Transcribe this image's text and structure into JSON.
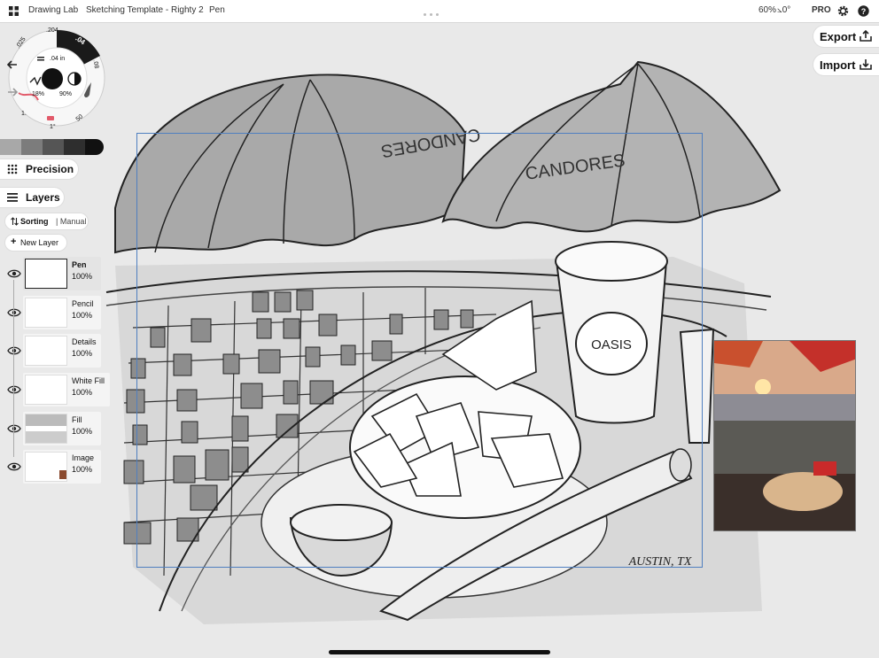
{
  "topbar": {
    "gallery": "Drawing Lab",
    "document": "Sketching Template - Righty 2",
    "tool": "Pen",
    "zoom": "60%",
    "rotation": "⦣0°",
    "pro": "PRO"
  },
  "brush_wheel": {
    "size_small": ".025",
    "size_mid": ".204",
    "size_active": ".04",
    "size_right": ".08",
    "size_center": ".04 in",
    "smoothing": "18%",
    "opacity": "90%",
    "value_bottom_left": "1.",
    "value_bottom": "1°",
    "value_bottom_right": "50"
  },
  "left_panel": {
    "precision": "Precision",
    "layers": "Layers",
    "sorting_label": "Sorting",
    "sorting_mode": "| Manual",
    "new_layer": "New Layer",
    "layers_list": [
      {
        "name": "Pen",
        "opacity": "100%",
        "active": true
      },
      {
        "name": "Pencil",
        "opacity": "100%"
      },
      {
        "name": "Details",
        "opacity": "100%"
      },
      {
        "name": "White Fill",
        "opacity": "100%"
      },
      {
        "name": "Fill",
        "opacity": "100%"
      },
      {
        "name": "Image",
        "opacity": "100%"
      }
    ]
  },
  "right_panel": {
    "export": "Export",
    "import": "Import"
  },
  "canvas": {
    "cup_text": "OASIS",
    "umbrella_text": "CANDORES",
    "signature": "AUSTIN, TX"
  },
  "colors": {
    "selection_frame": "#4f7fc0",
    "pencil_fill": "#e25a6a",
    "umbrella_gray": "#9a9a9a"
  }
}
